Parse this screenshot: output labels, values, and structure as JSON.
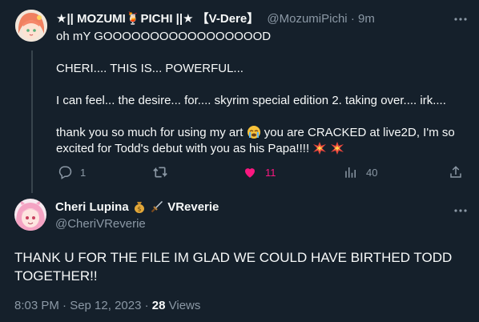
{
  "tweet1": {
    "display_name": "★|| MOZUMI🍹PICHI ||★  【V-Dere】",
    "handle": "@MozumiPichi",
    "separator": "·",
    "time": "9m",
    "lines": [
      "oh mY GOOOOOOOOOOOOOOOOOD",
      "CHERI.... THIS IS... POWERFUL...",
      "I can feel... the desire... for.... skyrim special edition 2. taking over.... irk....",
      "thank you so much for using my art",
      "you are CRACKED at live2D, I'm so",
      "excited for Todd's debut with you as his Papa!!!!"
    ],
    "replies": "1",
    "likes": "11",
    "views": "40"
  },
  "tweet2": {
    "display_name": "Cheri Lupina",
    "name_suffix": "VReverie",
    "handle": "@CheriVReverie",
    "text": "THANK U FOR THE FILE IM GLAD WE COULD HAVE BIRTHED TODD TOGETHER!!",
    "date": "8:03 PM · Sep 12, 2023 ·",
    "views_count": "28",
    "views_label": "Views"
  },
  "icons": {
    "more": "more-horizontal-icon",
    "reply": "reply-icon",
    "retweet": "retweet-icon",
    "like": "heart-icon",
    "views": "analytics-icon",
    "share": "share-icon",
    "emoji_cry": "loudly-crying-face-emoji",
    "emoji_collision": "collision-emoji",
    "emoji_moneybag": "money-bag-emoji",
    "emoji_dagger": "dagger-emoji"
  },
  "colors": {
    "background": "#15202b",
    "text": "#f7f9f9",
    "muted": "#8b98a5",
    "like_pink": "#f91880"
  }
}
